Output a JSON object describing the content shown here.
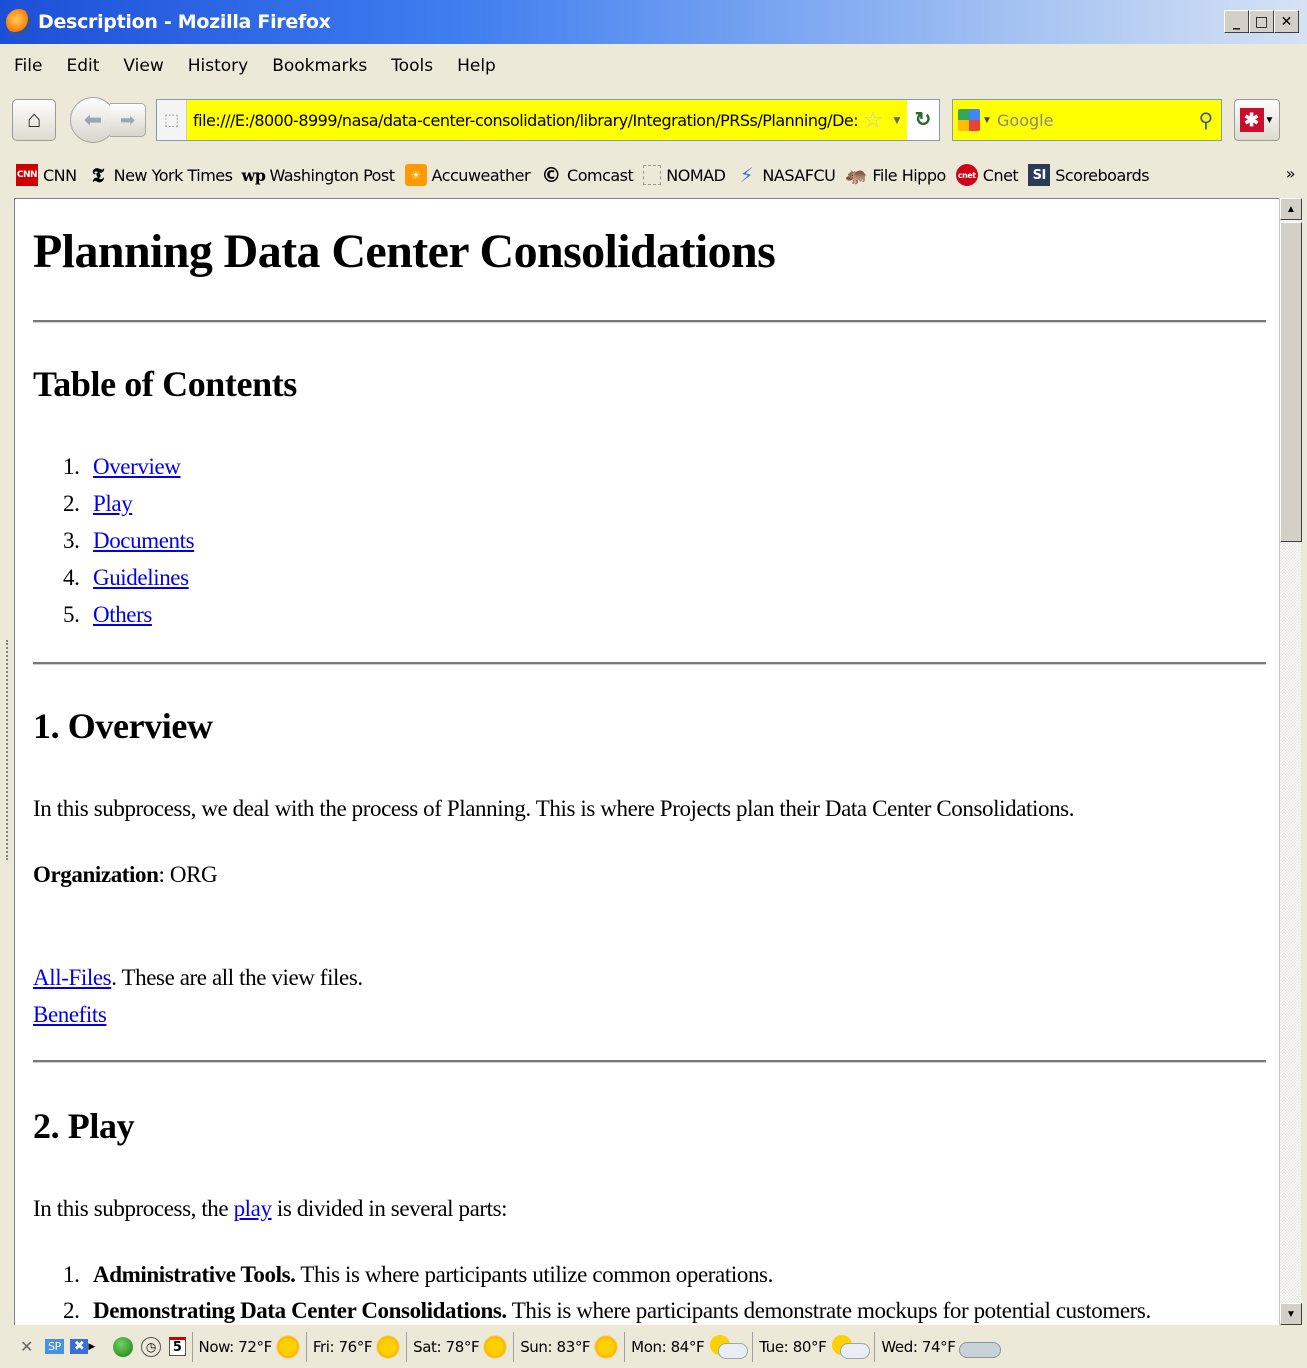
{
  "window": {
    "title": "Description - Mozilla Firefox",
    "buttons": {
      "minimize": "_",
      "maximize": "□",
      "close": "✕"
    }
  },
  "menu": [
    "File",
    "Edit",
    "View",
    "History",
    "Bookmarks",
    "Tools",
    "Help"
  ],
  "navbar": {
    "url": "file:///E:/8000-8999/nasa/data-center-consolidation/library/Integration/PRSs/Planning/De:",
    "search_placeholder": "Google"
  },
  "bookmarks": [
    {
      "label": "CNN",
      "icon": "cnn-icon"
    },
    {
      "label": "New York Times",
      "icon": "nyt-icon"
    },
    {
      "label": "Washington Post",
      "icon": "wp-icon"
    },
    {
      "label": "Accuweather",
      "icon": "accuweather-icon"
    },
    {
      "label": "Comcast",
      "icon": "comcast-icon"
    },
    {
      "label": "NOMAD",
      "icon": "page-icon"
    },
    {
      "label": "NASAFCU",
      "icon": "nasafcu-icon"
    },
    {
      "label": "File Hippo",
      "icon": "filehippo-icon"
    },
    {
      "label": "Cnet",
      "icon": "cnet-icon"
    },
    {
      "label": "Scoreboards",
      "icon": "si-icon"
    }
  ],
  "page": {
    "title": "Planning Data Center Consolidations",
    "toc_heading": "Table of Contents",
    "toc": [
      {
        "num": "1.",
        "label": "Overview"
      },
      {
        "num": "2.",
        "label": "Play"
      },
      {
        "num": "3.",
        "label": "Documents"
      },
      {
        "num": "4.",
        "label": "Guidelines"
      },
      {
        "num": "5.",
        "label": "Others"
      }
    ],
    "overview": {
      "heading": "1. Overview",
      "intro": "In this subprocess, we deal with the process of Planning. This is where Projects plan their Data Center Consolidations.",
      "org_label": "Organization",
      "org_value": ": ORG",
      "allfiles_link": "All-Files",
      "allfiles_text": ". These are all the view files.",
      "benefits_link": "Benefits"
    },
    "play": {
      "heading": "2. Play",
      "intro_before": "In this subprocess, the ",
      "intro_link": "play",
      "intro_after": " is divided in several parts:",
      "items": [
        {
          "num": "1.",
          "bold": "Administrative Tools.",
          "text": " This is where participants utilize common operations."
        },
        {
          "num": "2.",
          "bold": "Demonstrating Data Center Consolidations.",
          "text": " This is where participants demonstrate mockups for potential customers."
        }
      ]
    }
  },
  "statusbar": {
    "weather": [
      {
        "label": "Now: 72°F",
        "icon": "sun-icon"
      },
      {
        "label": "Fri: 76°F",
        "icon": "sun-icon"
      },
      {
        "label": "Sat: 78°F",
        "icon": "sun-icon"
      },
      {
        "label": "Sun: 83°F",
        "icon": "sun-icon"
      },
      {
        "label": "Mon: 84°F",
        "icon": "partly-cloudy-icon"
      },
      {
        "label": "Tue: 80°F",
        "icon": "partly-cloudy-icon"
      },
      {
        "label": "Wed: 74°F",
        "icon": "cloudy-icon"
      }
    ],
    "calendar_day": "5"
  }
}
